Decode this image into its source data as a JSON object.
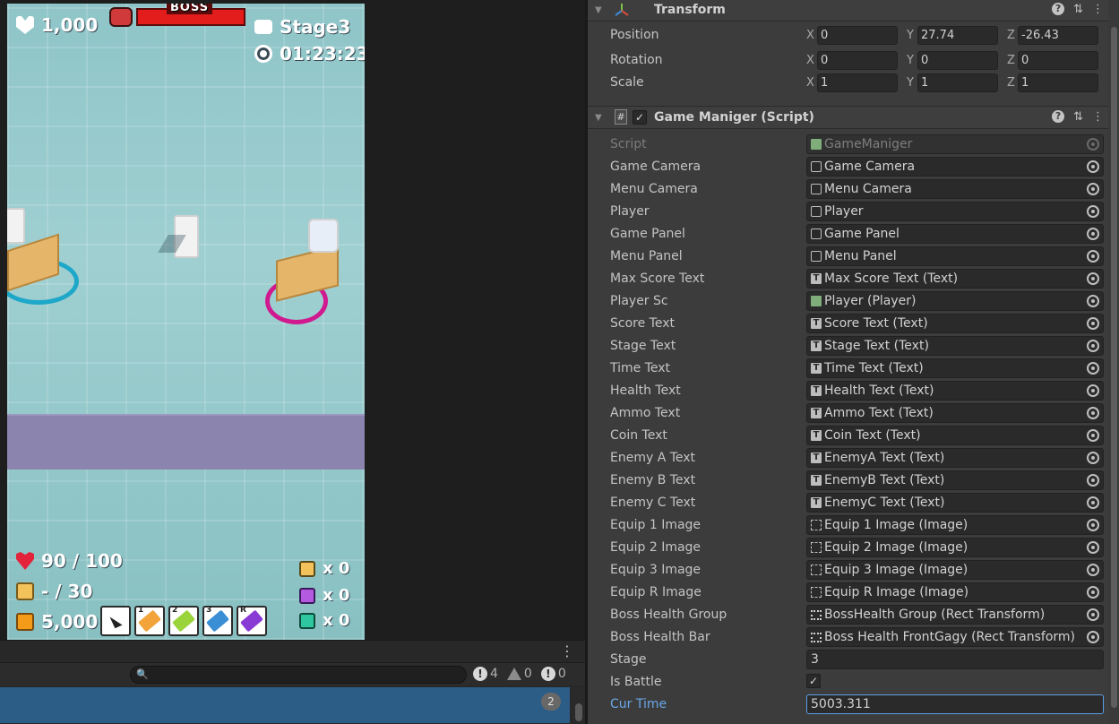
{
  "game": {
    "hud": {
      "score": "1,000",
      "boss_label": "BOSS",
      "stage": "Stage3",
      "time": "01:23:23",
      "health": "90 / 100",
      "ammo": "- / 30",
      "coins": "5,000",
      "enemy_a": "x 0",
      "enemy_b": "x 0",
      "enemy_c": "x 0"
    },
    "weapon_slots": [
      {
        "num": "",
        "icon": "cursor-icon"
      },
      {
        "num": "1",
        "icon": "hammer-icon"
      },
      {
        "num": "2",
        "icon": "handgun-icon"
      },
      {
        "num": "3",
        "icon": "smg-icon"
      },
      {
        "num": "R",
        "icon": "grenade-icon"
      }
    ],
    "colors": {
      "boss_bar": "#e31c1c",
      "ring_left": "#1da7c9",
      "ring_right": "#d0198e"
    }
  },
  "console": {
    "search_placeholder": "",
    "log_count": "4",
    "warn_count": "0",
    "error_count": "0",
    "entry_badge": "2"
  },
  "inspector": {
    "transform": {
      "title": "Transform",
      "rows": [
        {
          "label": "Position",
          "x": "0",
          "y": "27.74",
          "z": "-26.43"
        },
        {
          "label": "Rotation",
          "x": "0",
          "y": "0",
          "z": "0"
        },
        {
          "label": "Scale",
          "x": "1",
          "y": "1",
          "z": "1"
        }
      ]
    },
    "script_component": {
      "title": "Game Maniger (Script)",
      "script_label": "Script",
      "script_value": "GameManiger",
      "fields": [
        {
          "label": "Game Camera",
          "value": "Game Camera",
          "icon": "gameobject-icon"
        },
        {
          "label": "Menu Camera",
          "value": "Menu Camera",
          "icon": "gameobject-icon"
        },
        {
          "label": "Player",
          "value": "Player",
          "icon": "gameobject-icon"
        },
        {
          "label": "Game Panel",
          "value": "Game Panel",
          "icon": "gameobject-icon"
        },
        {
          "label": "Menu Panel",
          "value": "Menu Panel",
          "icon": "gameobject-icon"
        },
        {
          "label": "Max Score Text",
          "value": "Max Score Text (Text)",
          "icon": "text-icon"
        },
        {
          "label": "Player Sc",
          "value": "Player (Player)",
          "icon": "script-icon"
        },
        {
          "label": "Score Text",
          "value": "Score Text (Text)",
          "icon": "text-icon"
        },
        {
          "label": "Stage Text",
          "value": "Stage Text (Text)",
          "icon": "text-icon"
        },
        {
          "label": "Time Text",
          "value": "Time Text (Text)",
          "icon": "text-icon"
        },
        {
          "label": "Health Text",
          "value": "Health Text (Text)",
          "icon": "text-icon"
        },
        {
          "label": "Ammo Text",
          "value": "Ammo Text (Text)",
          "icon": "text-icon"
        },
        {
          "label": "Coin Text",
          "value": "Coin Text (Text)",
          "icon": "text-icon"
        },
        {
          "label": "Enemy A Text",
          "value": "EnemyA Text (Text)",
          "icon": "text-icon"
        },
        {
          "label": "Enemy B Text",
          "value": "EnemyB Text (Text)",
          "icon": "text-icon"
        },
        {
          "label": "Enemy C Text",
          "value": "EnemyC Text (Text)",
          "icon": "text-icon"
        },
        {
          "label": "Equip 1 Image",
          "value": "Equip 1 Image (Image)",
          "icon": "image-icon"
        },
        {
          "label": "Equip 2 Image",
          "value": "Equip 2 Image (Image)",
          "icon": "image-icon"
        },
        {
          "label": "Equip 3 Image",
          "value": "Equip 3 Image (Image)",
          "icon": "image-icon"
        },
        {
          "label": "Equip R Image",
          "value": "Equip R Image (Image)",
          "icon": "image-icon"
        },
        {
          "label": "Boss Health Group",
          "value": "BossHealth Group (Rect Transform)",
          "icon": "recttransform-icon"
        },
        {
          "label": "Boss Health Bar",
          "value": "Boss Health FrontGagy (Rect Transform)",
          "icon": "recttransform-icon"
        }
      ],
      "stage_label": "Stage",
      "stage_value": "3",
      "is_battle_label": "Is Battle",
      "is_battle_checked": "✓",
      "cur_time_label": "Cur Time",
      "cur_time_value": "5003.311"
    }
  }
}
